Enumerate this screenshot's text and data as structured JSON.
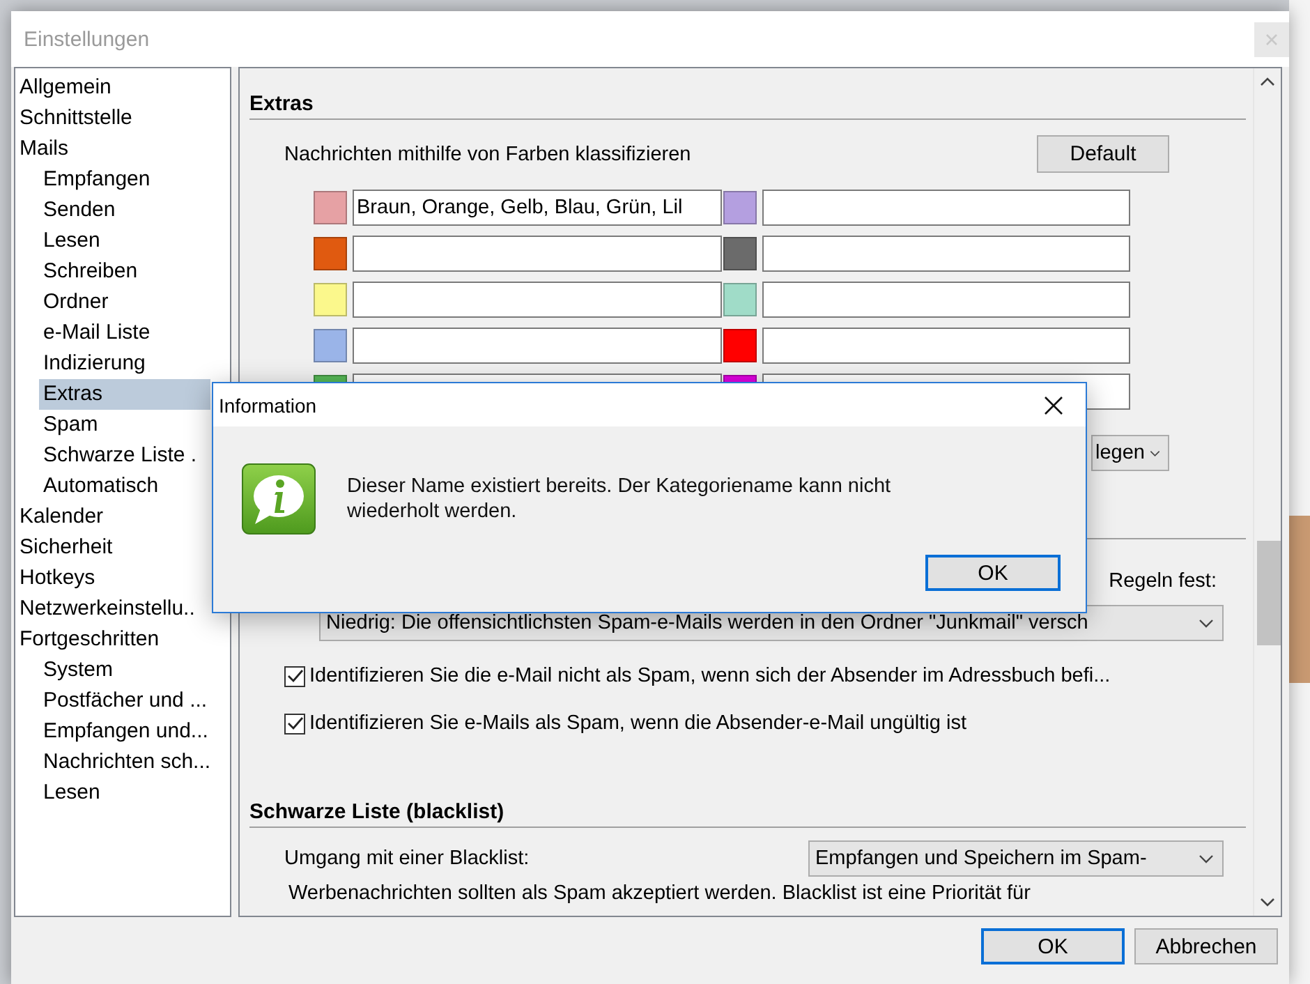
{
  "window": {
    "title": "Einstellungen"
  },
  "sidebar": {
    "items": [
      {
        "label": "Allgemein",
        "selected": false
      },
      {
        "label": "Schnittstelle",
        "selected": false
      },
      {
        "label": "Mails",
        "selected": false,
        "children": [
          {
            "label": "Empfangen",
            "selected": false
          },
          {
            "label": "Senden",
            "selected": false
          },
          {
            "label": "Lesen",
            "selected": false
          },
          {
            "label": "Schreiben",
            "selected": false
          },
          {
            "label": "Ordner",
            "selected": false
          },
          {
            "label": "e-Mail Liste",
            "selected": false
          },
          {
            "label": "Indizierung",
            "selected": false
          },
          {
            "label": "Extras",
            "selected": true
          },
          {
            "label": "Spam",
            "selected": false
          },
          {
            "label": "Schwarze Liste .",
            "selected": false
          },
          {
            "label": "Automatisch",
            "selected": false
          }
        ]
      },
      {
        "label": "Kalender",
        "selected": false
      },
      {
        "label": "Sicherheit",
        "selected": false
      },
      {
        "label": "Hotkeys",
        "selected": false
      },
      {
        "label": "Netzwerkeinstellu..",
        "selected": false
      },
      {
        "label": "Fortgeschritten",
        "selected": false,
        "children": [
          {
            "label": "System",
            "selected": false
          },
          {
            "label": "Postfächer und ...",
            "selected": false
          },
          {
            "label": "Empfangen und...",
            "selected": false
          },
          {
            "label": "Nachrichten sch...",
            "selected": false
          },
          {
            "label": "Lesen",
            "selected": false
          }
        ]
      }
    ]
  },
  "content": {
    "section_title": "Extras",
    "color_label": "Nachrichten mithilfe von Farben klassifizieren",
    "default_button": "Default",
    "categories": [
      {
        "color": "#e6a1a4",
        "value": "Braun, Orange, Gelb, Blau, Grün, Lil"
      },
      {
        "color": "#b49fe0"
      },
      {
        "color": "#e05a10"
      },
      {
        "color": "#6b6b6b"
      },
      {
        "color": "#fbf88c"
      },
      {
        "color": "#a0dcc8"
      },
      {
        "color": "#9ab4e8"
      },
      {
        "color": "#ff0000"
      },
      {
        "color": "#55b855"
      },
      {
        "color": "#e000e0"
      }
    ],
    "sort_dropdown": {
      "value": "legen"
    },
    "spam_rule_label": "Regeln fest:",
    "spam_level": {
      "value": "Niedrig: Die offensichtlichsten Spam-e-Mails werden in den Ordner \"Junkmail\" versch"
    },
    "checkboxes": [
      {
        "label": "Identifizieren Sie die e-Mail nicht als Spam, wenn sich der Absender im Adressbuch befi...",
        "checked": true
      },
      {
        "label": "Identifizieren Sie e-Mails als Spam, wenn die Absender-e-Mail ungültig ist",
        "checked": true
      }
    ],
    "blacklist_title": "Schwarze Liste (blacklist)",
    "blacklist_label": "Umgang mit einer Blacklist:",
    "blacklist_dropdown": {
      "value": "Empfangen und Speichern im Spam-"
    },
    "note": "Werbenachrichten sollten als Spam akzeptiert werden. Blacklist ist eine Priorität für"
  },
  "buttons": [
    {
      "label": "OK",
      "kind": "primary"
    },
    {
      "label": "Abbrechen",
      "kind": "normal"
    }
  ],
  "dialog": {
    "title": "Information",
    "message": "Dieser Name existiert bereits. Der Kategoriename kann nicht wiederholt werden.",
    "button": "OK"
  }
}
